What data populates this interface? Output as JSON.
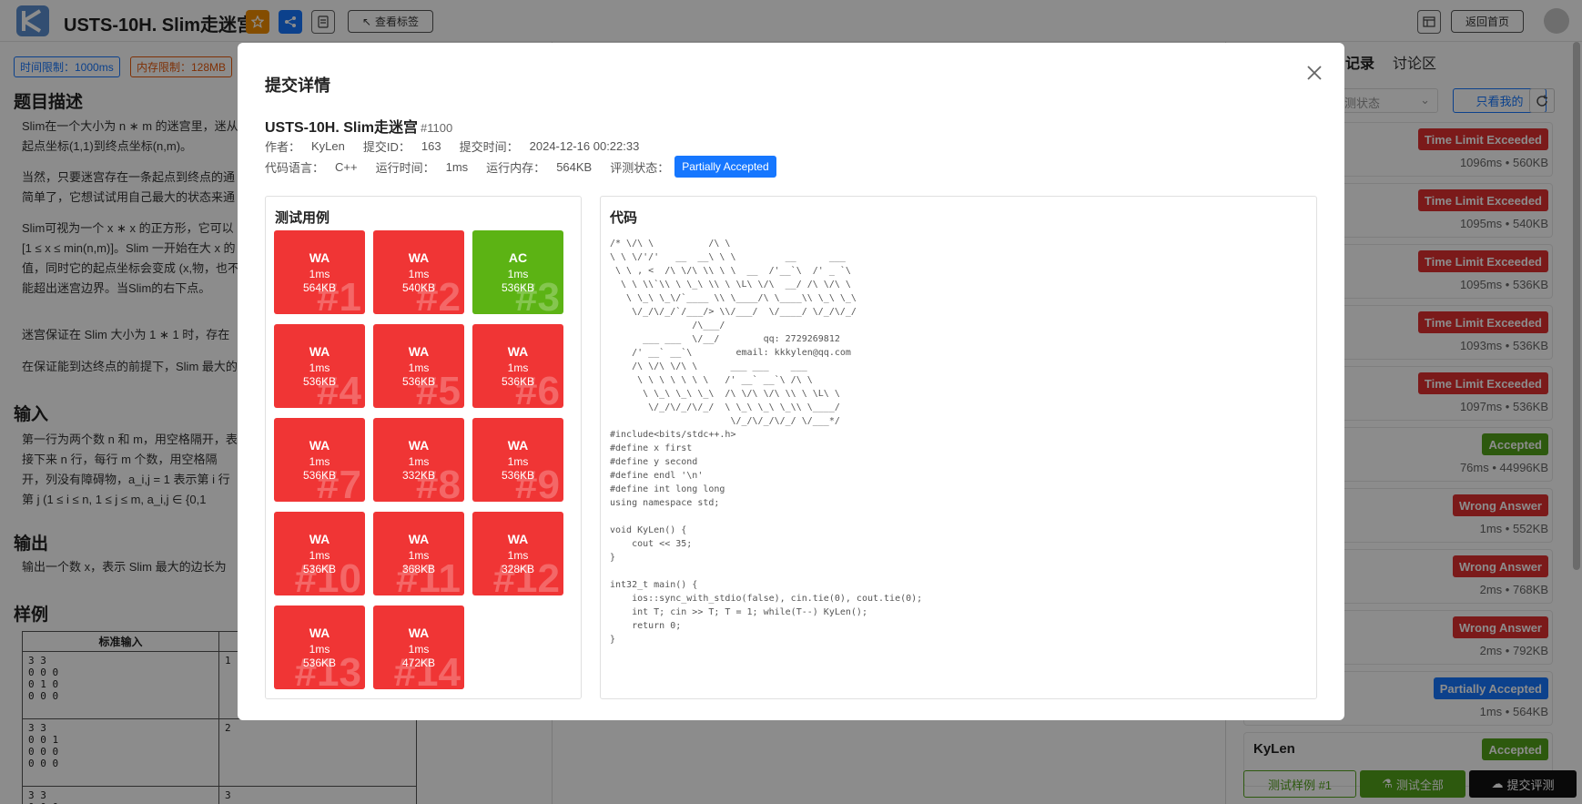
{
  "header": {
    "title": "USTS-10H. Slim走迷宫",
    "tags_button": "查看标签",
    "home_button": "返回首页"
  },
  "problem": {
    "time_limit": "时间限制：1000ms",
    "memory_limit": "内存限制：128MB",
    "desc_title": "题目描述",
    "desc_p1": "Slim在一个大小为 n ∗ m 的迷宫里，迷从起点坐标(1,1)到终点坐标(n,m)。",
    "desc_p2": "当然，只要迷宫存在一条起点到终点的通简单了，它想试试用自己最大的状态来通",
    "desc_p3": "Slim可视为一个 x ∗ x 的正方形，它可以[1 ≤ x ≤ min(n,m)]。Slim 一开始在大 x 的值，同时它的起点坐标会变成 (x,物，也不能超出迷宫边界。当Slim的右下点。",
    "desc_p4": "迷宫保证在 Slim 大小为 1 ∗ 1 时，存在",
    "desc_p5": "在保证能到达终点的前提下，Slim 最大的",
    "input_title": "输入",
    "input_p": "第一行为两个数 n 和 m，用空格隔开，表接下来 n 行，每行 m 个数，用空格隔开，列没有障碍物，a_i,j = 1 表示第 i 行第 j (1 ≤ i ≤ n, 1 ≤ j ≤ m, a_i,j ∈ {0,1",
    "output_title": "输出",
    "output_p": "输出一个数 x，表示 Slim 最大的边长为",
    "sample_title": "样例",
    "sample_header": "标准输入",
    "samples": [
      {
        "input": "3 3\n0 0 0\n0 1 0\n0 0 0",
        "output": "1"
      },
      {
        "input": "3 3\n0 0 1\n0 0 0\n0 0 0",
        "output": "2"
      },
      {
        "input": "3 3\n0 0 0",
        "output": "3"
      }
    ]
  },
  "right_panel": {
    "tabs": [
      "记录",
      "讨论区"
    ],
    "status_placeholder": "测状态",
    "mine_button": "只看我的",
    "submissions": [
      {
        "user": "",
        "status": "Time Limit Exceeded",
        "meta": "1096ms • 560KB",
        "color": "#e03131"
      },
      {
        "user": "",
        "status": "Time Limit Exceeded",
        "meta": "1095ms • 540KB",
        "color": "#e03131"
      },
      {
        "user": "",
        "status": "Time Limit Exceeded",
        "meta": "1095ms • 536KB",
        "color": "#e03131"
      },
      {
        "user": "",
        "status": "Time Limit Exceeded",
        "meta": "1093ms • 536KB",
        "color": "#e03131"
      },
      {
        "user": "",
        "status": "Time Limit Exceeded",
        "meta": "1097ms • 536KB",
        "color": "#e03131"
      },
      {
        "user": "",
        "status": "Accepted",
        "meta": "76ms • 44996KB",
        "color": "#52a31a"
      },
      {
        "user": "",
        "status": "Wrong Answer",
        "meta": "1ms • 552KB",
        "color": "#e03131"
      },
      {
        "user": "",
        "status": "Wrong Answer",
        "meta": "2ms • 768KB",
        "color": "#e03131"
      },
      {
        "user": "",
        "status": "Wrong Answer",
        "meta": "2ms • 792KB",
        "color": "#e03131"
      },
      {
        "user": "",
        "status": "Partially Accepted",
        "meta": "1ms • 564KB",
        "color": "#1677ff"
      },
      {
        "user": "KyLen",
        "status": "Accepted",
        "meta": "",
        "color": "#52a31a"
      }
    ],
    "test_sample_button": "测试样例 #1",
    "test_all_button": "测试全部",
    "submit_button": "提交评测"
  },
  "modal": {
    "title": "提交详情",
    "problem_title": "USTS-10H. Slim走迷宫",
    "problem_id": "#1100",
    "author_label": "作者：",
    "author": "KyLen",
    "submit_id_label": "提交ID：",
    "submit_id": "163",
    "submit_time_label": "提交时间：",
    "submit_time": "2024-12-16 00:22:33",
    "lang_label": "代码语言：",
    "lang": "C++",
    "runtime_label": "运行时间：",
    "runtime": "1ms",
    "memory_label": "运行内存：",
    "memory": "564KB",
    "judge_label": "评测状态：",
    "judge_status": "Partially Accepted",
    "testcases_title": "测试用例",
    "code_title": "代码",
    "testcases": [
      {
        "verdict": "WA",
        "time": "1ms",
        "memory": "564KB",
        "num": "#1"
      },
      {
        "verdict": "WA",
        "time": "1ms",
        "memory": "540KB",
        "num": "#2"
      },
      {
        "verdict": "AC",
        "time": "1ms",
        "memory": "536KB",
        "num": "#3"
      },
      {
        "verdict": "WA",
        "time": "1ms",
        "memory": "536KB",
        "num": "#4"
      },
      {
        "verdict": "WA",
        "time": "1ms",
        "memory": "536KB",
        "num": "#5"
      },
      {
        "verdict": "WA",
        "time": "1ms",
        "memory": "536KB",
        "num": "#6"
      },
      {
        "verdict": "WA",
        "time": "1ms",
        "memory": "536KB",
        "num": "#7"
      },
      {
        "verdict": "WA",
        "time": "1ms",
        "memory": "332KB",
        "num": "#8"
      },
      {
        "verdict": "WA",
        "time": "1ms",
        "memory": "536KB",
        "num": "#9"
      },
      {
        "verdict": "WA",
        "time": "1ms",
        "memory": "536KB",
        "num": "#10"
      },
      {
        "verdict": "WA",
        "time": "1ms",
        "memory": "368KB",
        "num": "#11"
      },
      {
        "verdict": "WA",
        "time": "1ms",
        "memory": "328KB",
        "num": "#12"
      },
      {
        "verdict": "WA",
        "time": "1ms",
        "memory": "536KB",
        "num": "#13"
      },
      {
        "verdict": "WA",
        "time": "1ms",
        "memory": "472KB",
        "num": "#14"
      }
    ],
    "colors": {
      "wa": "#f03535",
      "ac": "#5cb314"
    },
    "code": "/* \\/\\ \\          /\\ \\\n\\ \\ \\/'/'   __  __\\ \\ \\         __      ___\n \\ \\ , <  /\\ \\/\\ \\\\ \\ \\  __  /'__`\\  /' _ `\\\n  \\ \\ \\\\`\\\\ \\ \\_\\ \\\\ \\ \\L\\ \\/\\  __/ /\\ \\/\\ \\\n   \\ \\_\\ \\_\\/`____ \\\\ \\____/\\ \\____\\\\ \\_\\ \\_\\\n    \\/_/\\/_/`/___/> \\\\/___/  \\/____/ \\/_/\\/_/\n               /\\___/\n      ___ ___  \\/__/        qq: 2729269812\n    /' __` __`\\        email: kkkylen@qq.com\n    /\\ \\/\\ \\/\\ \\      ___ ___    ___\n     \\ \\ \\ \\ \\ \\ \\   /' __` __`\\ /\\ \\\n      \\ \\_\\ \\_\\ \\_\\  /\\ \\/\\ \\/\\ \\\\ \\ \\L\\ \\\n       \\/_/\\/_/\\/_/  \\ \\_\\ \\_\\ \\_\\\\ \\____/\n                      \\/_/\\/_/\\/_/ \\/___*/\n#include<bits/stdc++.h>\n#define x first\n#define y second\n#define endl '\\n'\n#define int long long\nusing namespace std;\n\nvoid KyLen() {\n    cout << 35;\n}\n\nint32_t main() {\n    ios::sync_with_stdio(false), cin.tie(0), cout.tie(0);\n    int T; cin >> T; T = 1; while(T--) KyLen();\n    return 0;\n}"
  }
}
